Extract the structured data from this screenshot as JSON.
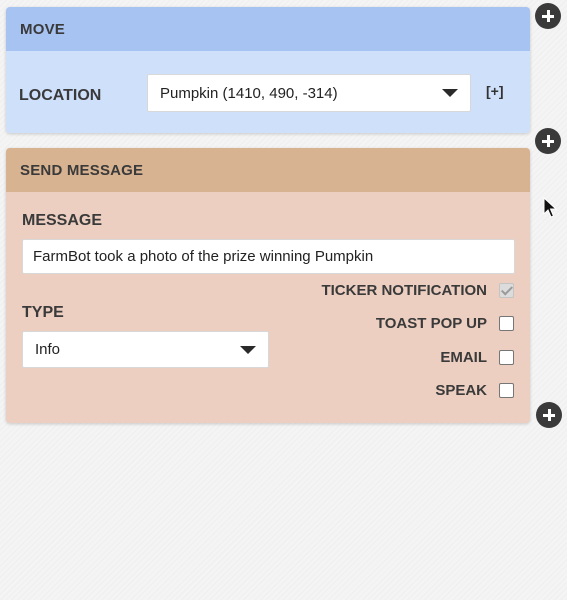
{
  "move_step": {
    "title": "MOVE",
    "location_label": "LOCATION",
    "location_value": "Pumpkin (1410, 490, -314)",
    "add_variable_label": "[+]",
    "header_color": "#a6c3f2",
    "body_color": "#cfe0fb"
  },
  "send_message_step": {
    "title": "SEND MESSAGE",
    "message_label": "MESSAGE",
    "message_value": "FarmBot took a photo of the prize winning Pumpkin",
    "type_label": "TYPE",
    "type_value": "Info",
    "channels": [
      {
        "label": "TICKER NOTIFICATION",
        "checked": true,
        "disabled": true
      },
      {
        "label": "TOAST POP UP",
        "checked": false,
        "disabled": false
      },
      {
        "label": "EMAIL",
        "checked": false,
        "disabled": false
      },
      {
        "label": "SPEAK",
        "checked": false,
        "disabled": false
      }
    ],
    "header_color": "#d8b391",
    "body_color": "#eccfc1"
  },
  "header_icons": [
    "help-icon",
    "trash-icon",
    "duplicate-icon",
    "drag-handle-icon"
  ],
  "add_step_buttons": [
    "add-step-above",
    "add-step-between",
    "add-step-below"
  ]
}
